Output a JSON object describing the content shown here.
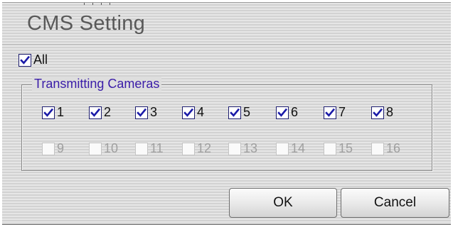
{
  "title": "CMS Setting",
  "all": {
    "label": "All",
    "checked": true
  },
  "group_label": "Transmitting Cameras",
  "cameras_row1": [
    {
      "label": "1",
      "checked": true,
      "enabled": true
    },
    {
      "label": "2",
      "checked": true,
      "enabled": true
    },
    {
      "label": "3",
      "checked": true,
      "enabled": true
    },
    {
      "label": "4",
      "checked": true,
      "enabled": true
    },
    {
      "label": "5",
      "checked": true,
      "enabled": true
    },
    {
      "label": "6",
      "checked": true,
      "enabled": true
    },
    {
      "label": "7",
      "checked": true,
      "enabled": true
    },
    {
      "label": "8",
      "checked": true,
      "enabled": true
    }
  ],
  "cameras_row2": [
    {
      "label": "9",
      "checked": false,
      "enabled": false
    },
    {
      "label": "10",
      "checked": false,
      "enabled": false
    },
    {
      "label": "11",
      "checked": false,
      "enabled": false
    },
    {
      "label": "12",
      "checked": false,
      "enabled": false
    },
    {
      "label": "13",
      "checked": false,
      "enabled": false
    },
    {
      "label": "14",
      "checked": false,
      "enabled": false
    },
    {
      "label": "15",
      "checked": false,
      "enabled": false
    },
    {
      "label": "16",
      "checked": false,
      "enabled": false
    }
  ],
  "buttons": {
    "ok": "OK",
    "cancel": "Cancel"
  },
  "colors": {
    "check": "#1a1aa8",
    "group_label": "#3a1ca8",
    "disabled_text": "#9f9f9f"
  },
  "icons": {
    "check": "checkmark-icon"
  }
}
